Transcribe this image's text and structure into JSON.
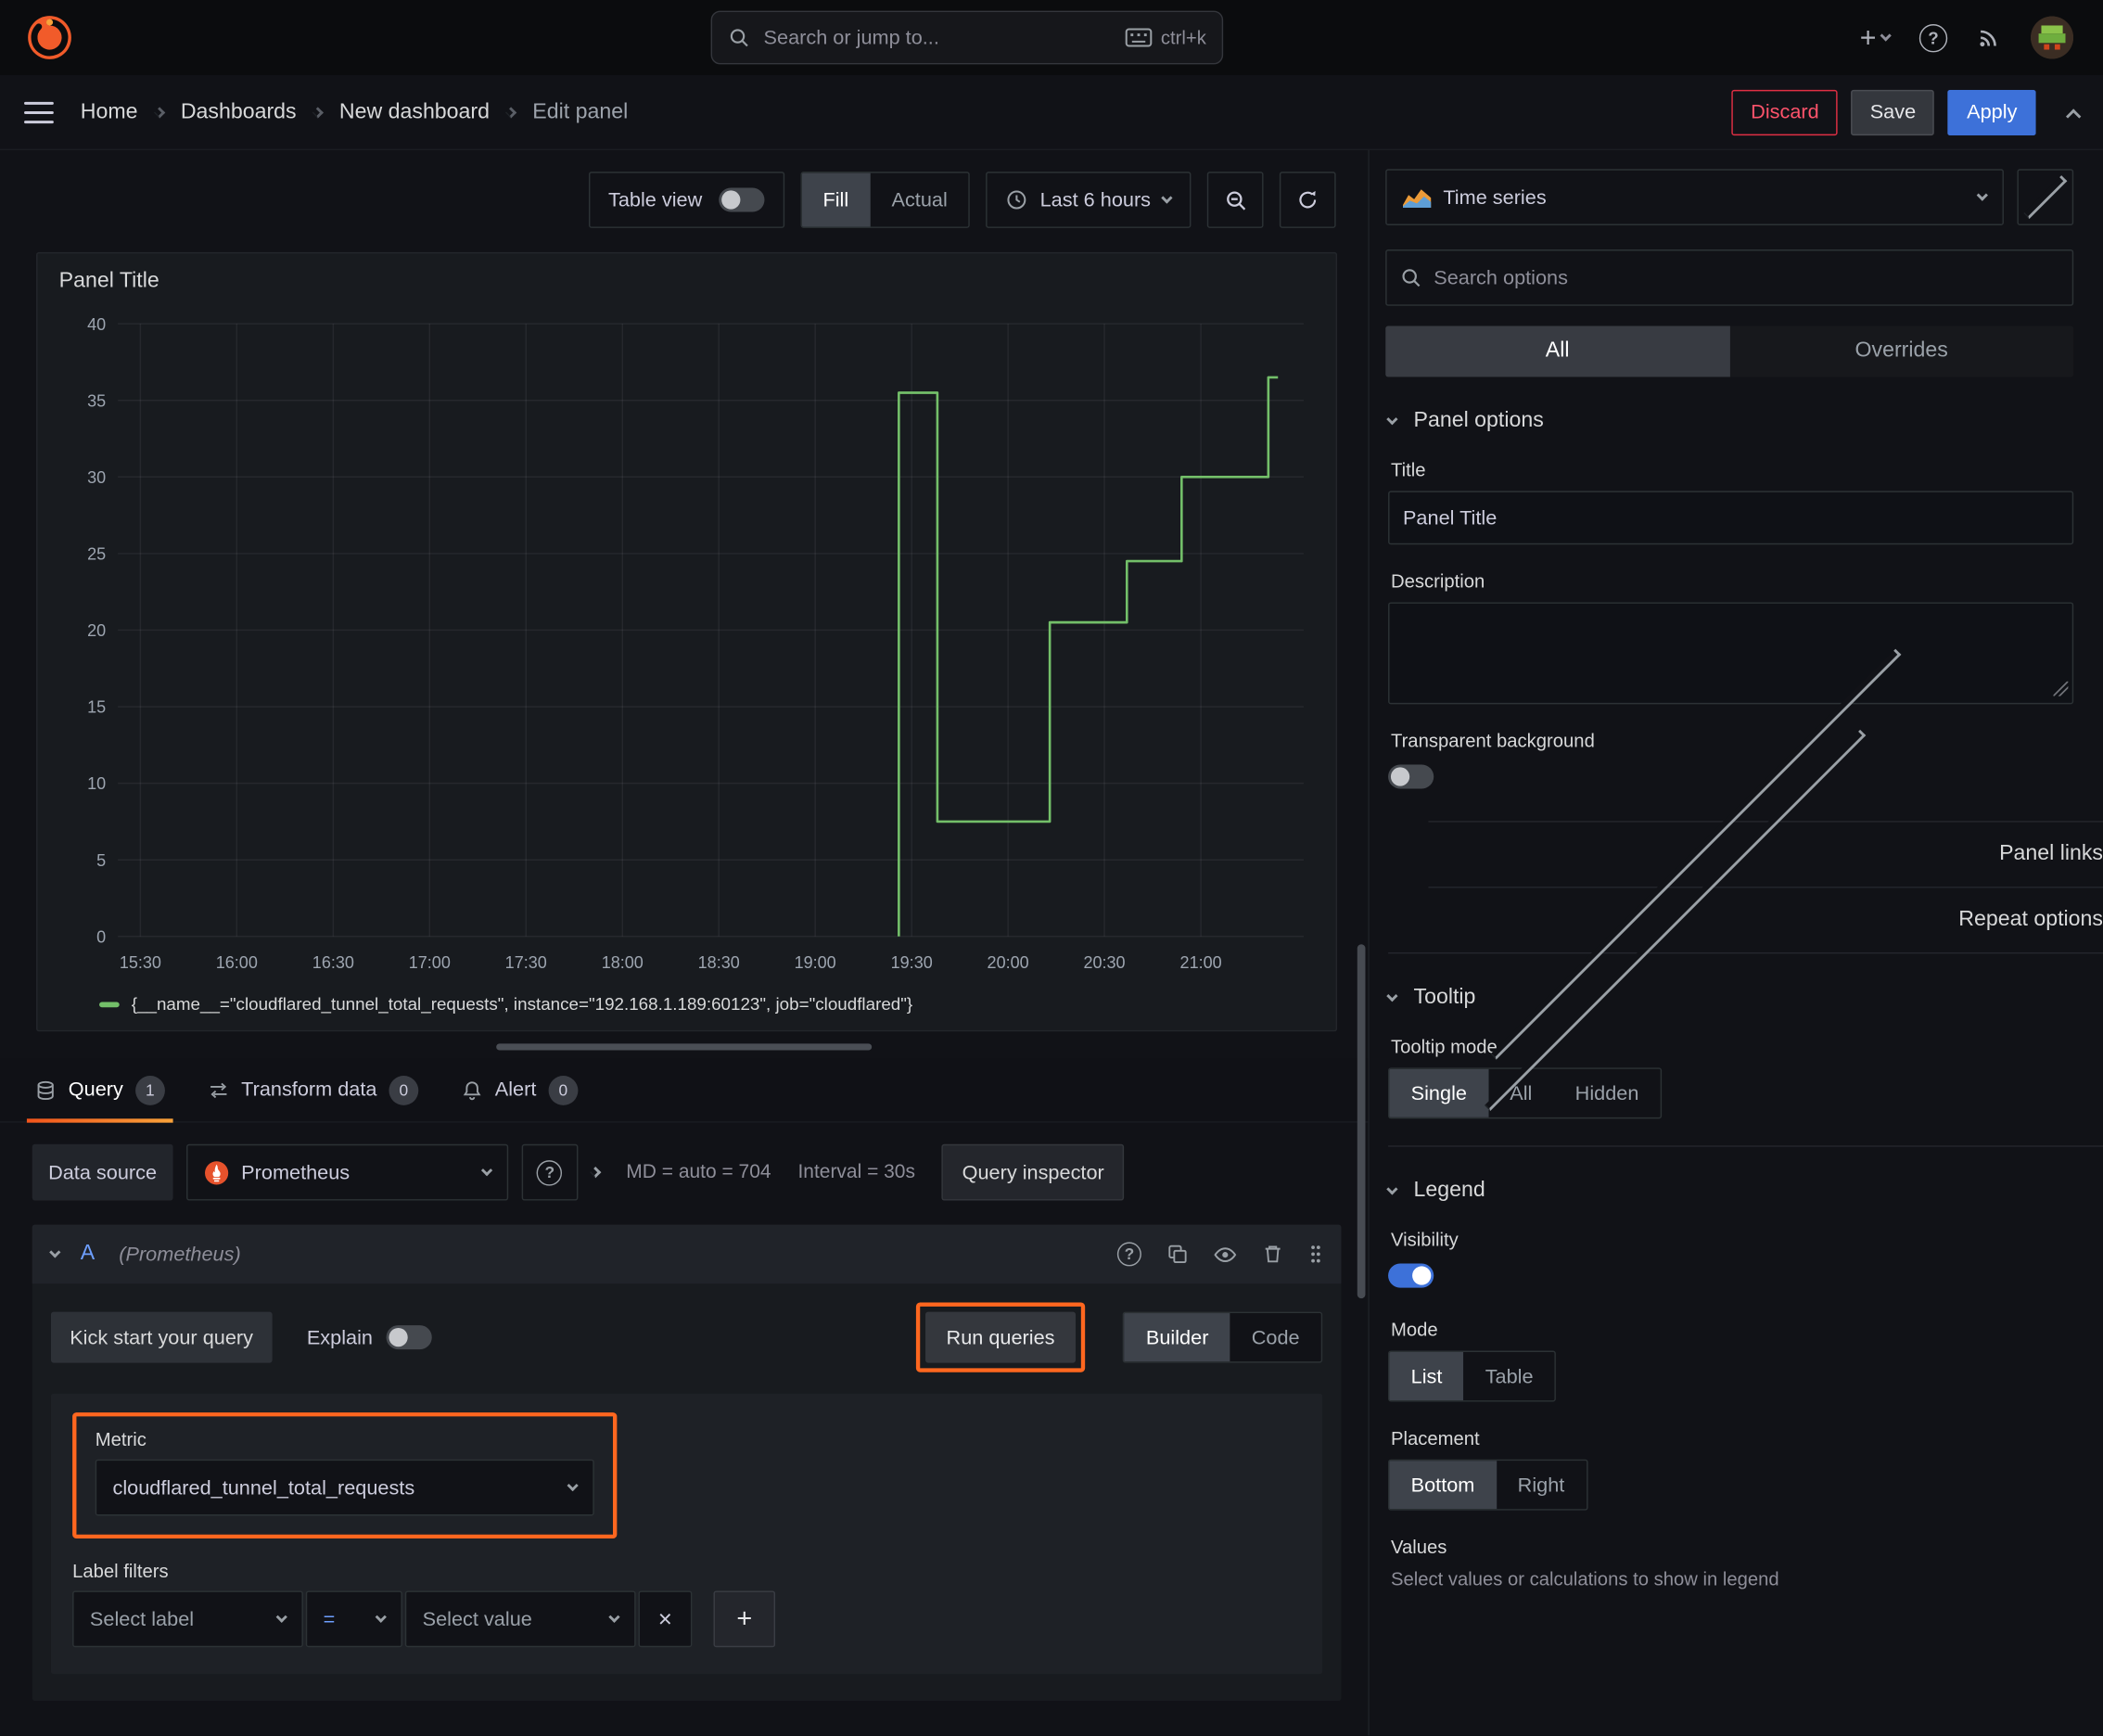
{
  "icons": {
    "add": "+",
    "question": "?",
    "remove": "×"
  },
  "colors": {
    "accent_blue": "#3d71d9",
    "series_green": "#73bf69",
    "annotation_orange": "#ff671f",
    "danger_red": "#e02f44",
    "tab_underline": "#f2541b"
  },
  "topbar": {
    "search_placeholder": "Search or jump to...",
    "shortcut": "ctrl+k"
  },
  "breadcrumb": {
    "items": [
      "Home",
      "Dashboards",
      "New dashboard",
      "Edit panel"
    ]
  },
  "actions": {
    "discard": "Discard",
    "save": "Save",
    "apply": "Apply"
  },
  "preview_toolbar": {
    "table_view_label": "Table view",
    "fill_label": "Fill",
    "actual_label": "Actual",
    "time_range_label": "Last 6 hours"
  },
  "panel": {
    "title": "Panel Title"
  },
  "chart_data": {
    "type": "line",
    "title": "Panel Title",
    "ylim": [
      0,
      40
    ],
    "y_ticks": [
      0,
      5,
      10,
      15,
      20,
      25,
      30,
      35,
      40
    ],
    "x_ticks": [
      "15:30",
      "16:00",
      "16:30",
      "17:00",
      "17:30",
      "18:00",
      "18:30",
      "19:00",
      "19:30",
      "20:00",
      "20:30",
      "21:00"
    ],
    "x_tick_minutes": [
      930,
      960,
      990,
      1020,
      1050,
      1080,
      1110,
      1140,
      1170,
      1200,
      1230,
      1260
    ],
    "x_domain_minutes": [
      923,
      1292
    ],
    "grid": true,
    "legend_position": "bottom",
    "series": [
      {
        "name": "{__name__=\"cloudflared_tunnel_total_requests\", instance=\"192.168.1.189:60123\", job=\"cloudflared\"}",
        "color": "#73bf69",
        "points_minutes_value": [
          [
            1166,
            0
          ],
          [
            1166,
            35.5
          ],
          [
            1178,
            35.5
          ],
          [
            1178,
            7.5
          ],
          [
            1213,
            7.5
          ],
          [
            1213,
            20.5
          ],
          [
            1237,
            20.5
          ],
          [
            1237,
            24.5
          ],
          [
            1254,
            24.5
          ],
          [
            1254,
            30
          ],
          [
            1281,
            30
          ],
          [
            1281,
            36.5
          ],
          [
            1284,
            36.5
          ]
        ]
      }
    ]
  },
  "tabs": {
    "query": {
      "label": "Query",
      "count": "1"
    },
    "transform": {
      "label": "Transform data",
      "count": "0"
    },
    "alert": {
      "label": "Alert",
      "count": "0"
    }
  },
  "query_editor": {
    "data_source_label": "Data source",
    "data_source_value": "Prometheus",
    "md_text": "MD = auto = 704",
    "interval_text": "Interval = 30s",
    "query_inspector_label": "Query inspector",
    "row_name": "A",
    "row_hint": "(Prometheus)",
    "kick_start_label": "Kick start your query",
    "explain_label": "Explain",
    "run_queries_label": "Run queries",
    "builder_label": "Builder",
    "code_label": "Code",
    "metric_label": "Metric",
    "metric_value": "cloudflared_tunnel_total_requests",
    "label_filters_label": "Label filters",
    "select_label_placeholder": "Select label",
    "operator_value": "=",
    "select_value_placeholder": "Select value"
  },
  "sidebar": {
    "viz_type": "Time series",
    "search_placeholder": "Search options",
    "tab_all": "All",
    "tab_overrides": "Overrides",
    "panel_options": {
      "header": "Panel options",
      "title_label": "Title",
      "title_value": "Panel Title",
      "description_label": "Description",
      "transparent_label": "Transparent background"
    },
    "panel_links_label": "Panel links",
    "repeat_options_label": "Repeat options",
    "tooltip": {
      "header": "Tooltip",
      "mode_label": "Tooltip mode",
      "options": [
        "Single",
        "All",
        "Hidden"
      ],
      "selected": "Single"
    },
    "legend": {
      "header": "Legend",
      "visibility_label": "Visibility",
      "mode_label": "Mode",
      "mode_options": [
        "List",
        "Table"
      ],
      "mode_selected": "List",
      "placement_label": "Placement",
      "placement_options": [
        "Bottom",
        "Right"
      ],
      "placement_selected": "Bottom",
      "values_label": "Values",
      "values_help": "Select values or calculations to show in legend"
    }
  }
}
